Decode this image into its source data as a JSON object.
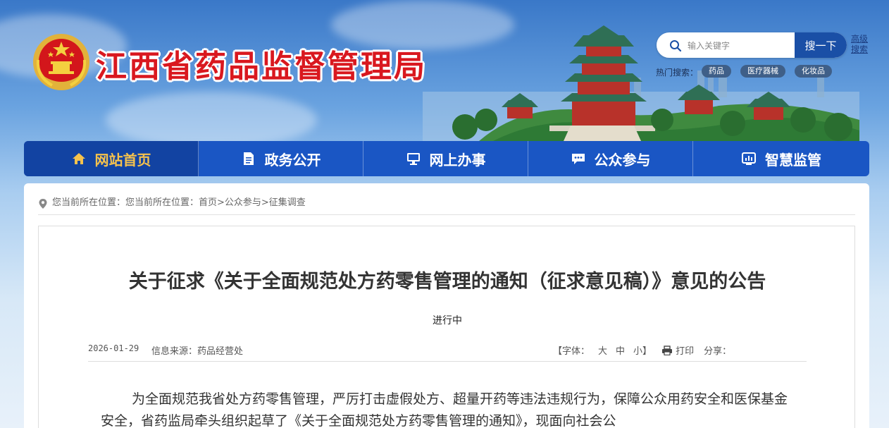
{
  "header": {
    "site_title": "江西省药品监督管理局",
    "search": {
      "placeholder": "输入关键字",
      "button_label": "搜一下",
      "advanced_label": "高级搜索"
    },
    "hot_search_label": "热门搜索：",
    "hot_tags": [
      "药品",
      "医疗器械",
      "化妆品"
    ]
  },
  "nav": {
    "items": [
      {
        "label": "网站首页",
        "icon": "home-icon",
        "active": true
      },
      {
        "label": "政务公开",
        "icon": "document-icon",
        "active": false
      },
      {
        "label": "网上办事",
        "icon": "monitor-icon",
        "active": false
      },
      {
        "label": "公众参与",
        "icon": "chat-icon",
        "active": false
      },
      {
        "label": "智慧监管",
        "icon": "dashboard-icon",
        "active": false
      }
    ]
  },
  "breadcrumb": {
    "prefix": "您当前所在位置：",
    "text": "您当前所在位置：首页>公众参与>征集调查"
  },
  "article": {
    "title": "关于征求《关于全面规范处方药零售管理的通知（征求意见稿）》意见的公告",
    "status": "进行中",
    "date": "2026-01-29",
    "source": "信息来源：药品经营处",
    "font_label_open": "【字体：",
    "font_large": "大",
    "font_medium": "中",
    "font_small": "小】",
    "print_label": "打印",
    "share_label": "分享：",
    "body": "为全面规范我省处方药零售管理，严厉打击虚假处方、超量开药等违法违规行为，保障公众用药安全和医保基金安全，省药监局牵头组织起草了《关于全面规范处方药零售管理的通知》，现面向社会公"
  },
  "colors": {
    "nav_bg": "#1a56c4",
    "nav_active_bg": "#1243a2",
    "nav_active_text": "#f5c24d",
    "title_red": "#d9181f",
    "search_button": "#1a4fa6"
  }
}
